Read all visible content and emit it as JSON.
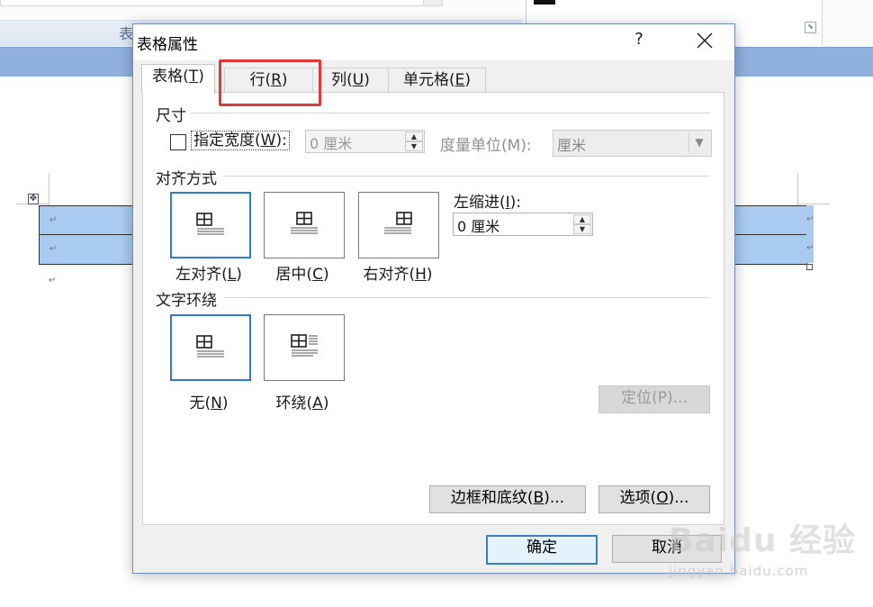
{
  "background": {
    "ribbon_group_label": "表",
    "paragraph_mark": "↵"
  },
  "dialog": {
    "title": "表格属性",
    "help_label": "?",
    "tabs": [
      {
        "label": "表格(",
        "key": "T",
        "suffix": ")"
      },
      {
        "label": "行(",
        "key": "R",
        "suffix": ")"
      },
      {
        "label": "列(",
        "key": "U",
        "suffix": ")"
      },
      {
        "label": "单元格(",
        "key": "E",
        "suffix": ")"
      }
    ],
    "size": {
      "heading": "尺寸",
      "specify_width_label": "指定宽度(",
      "specify_width_key": "W",
      "specify_width_suffix": "):",
      "width_value": "0 厘米",
      "measure_label": "度量单位(M):",
      "measure_value": "厘米"
    },
    "alignment": {
      "heading": "对齐方式",
      "options": [
        {
          "label": "左对齐(",
          "key": "L",
          "suffix": ")"
        },
        {
          "label": "居中(",
          "key": "C",
          "suffix": ")"
        },
        {
          "label": "右对齐(",
          "key": "H",
          "suffix": ")"
        }
      ],
      "indent_label": "左缩进(",
      "indent_key": "I",
      "indent_suffix": "):",
      "indent_value": "0 厘米"
    },
    "wrap": {
      "heading": "文字环绕",
      "options": [
        {
          "label": "无(",
          "key": "N",
          "suffix": ")"
        },
        {
          "label": "环绕(",
          "key": "A",
          "suffix": ")"
        }
      ],
      "position_button": "定位(P)..."
    },
    "borders_button": {
      "label": "边框和底纹(",
      "key": "B",
      "suffix": ")..."
    },
    "options_button": {
      "label": "选项(",
      "key": "O",
      "suffix": ")..."
    },
    "ok_button": "确定",
    "cancel_button": "取消"
  },
  "watermark": {
    "main": "Baidu 经验",
    "sub": "jingyan.baidu.com"
  },
  "colors": {
    "highlight": "#e0393b",
    "selection": "#2f7cc9",
    "table_fill": "#a9cbef",
    "title_band": "#8fb0dd"
  }
}
